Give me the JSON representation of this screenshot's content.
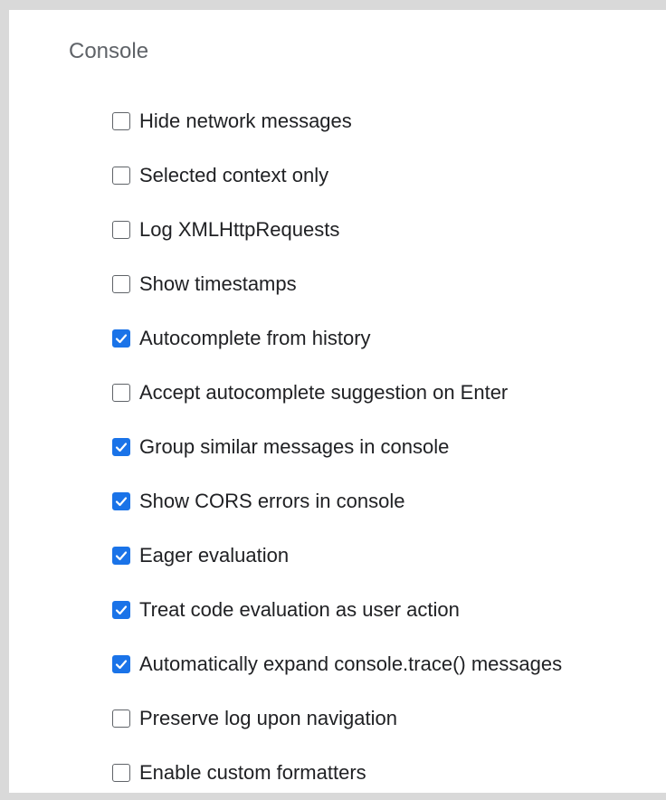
{
  "section": {
    "title": "Console"
  },
  "colors": {
    "accent": "#1a73e8",
    "text": "#202124",
    "muted": "#5f6368"
  },
  "settings": [
    {
      "label": "Hide network messages",
      "checked": false
    },
    {
      "label": "Selected context only",
      "checked": false
    },
    {
      "label": "Log XMLHttpRequests",
      "checked": false
    },
    {
      "label": "Show timestamps",
      "checked": false
    },
    {
      "label": "Autocomplete from history",
      "checked": true
    },
    {
      "label": "Accept autocomplete suggestion on Enter",
      "checked": false
    },
    {
      "label": "Group similar messages in console",
      "checked": true
    },
    {
      "label": "Show CORS errors in console",
      "checked": true
    },
    {
      "label": "Eager evaluation",
      "checked": true
    },
    {
      "label": "Treat code evaluation as user action",
      "checked": true
    },
    {
      "label": "Automatically expand console.trace() messages",
      "checked": true
    },
    {
      "label": "Preserve log upon navigation",
      "checked": false
    },
    {
      "label": "Enable custom formatters",
      "checked": false
    }
  ]
}
